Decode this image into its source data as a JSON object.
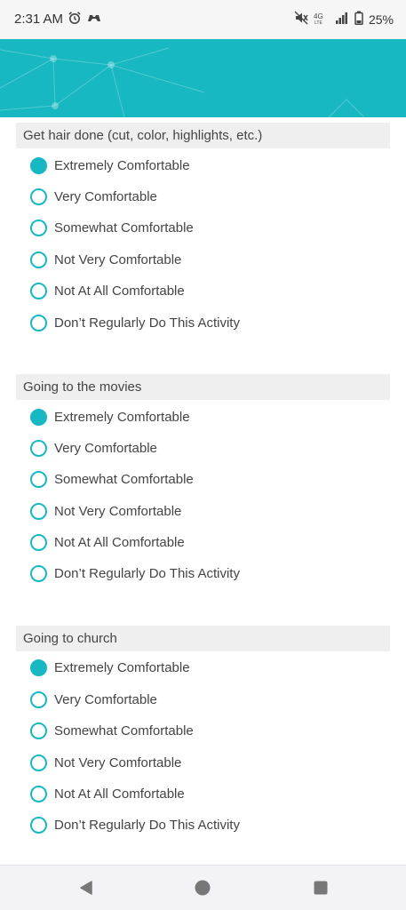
{
  "status_bar": {
    "time": "2:31 AM",
    "battery": "25%",
    "network": "4G LTE"
  },
  "colors": {
    "accent": "#17b8c2",
    "section_bg": "#efefef",
    "text": "#444444"
  },
  "questions": [
    {
      "title": "Get hair done (cut, color, highlights, etc.)",
      "options": [
        {
          "label": "Extremely Comfortable",
          "checked": true
        },
        {
          "label": "Very Comfortable",
          "checked": false
        },
        {
          "label": "Somewhat Comfortable",
          "checked": false
        },
        {
          "label": "Not Very Comfortable",
          "checked": false
        },
        {
          "label": "Not At All Comfortable",
          "checked": false
        },
        {
          "label": "Don’t Regularly Do This Activity",
          "checked": false
        }
      ]
    },
    {
      "title": "Going to the movies",
      "options": [
        {
          "label": "Extremely Comfortable",
          "checked": true
        },
        {
          "label": "Very Comfortable",
          "checked": false
        },
        {
          "label": "Somewhat Comfortable",
          "checked": false
        },
        {
          "label": "Not Very Comfortable",
          "checked": false
        },
        {
          "label": "Not At All Comfortable",
          "checked": false
        },
        {
          "label": "Don’t Regularly Do This Activity",
          "checked": false
        }
      ]
    },
    {
      "title": "Going to church",
      "options": [
        {
          "label": "Extremely Comfortable",
          "checked": true
        },
        {
          "label": "Very Comfortable",
          "checked": false
        },
        {
          "label": "Somewhat Comfortable",
          "checked": false
        },
        {
          "label": "Not Very Comfortable",
          "checked": false
        },
        {
          "label": "Not At All Comfortable",
          "checked": false
        },
        {
          "label": "Don’t Regularly Do This Activity",
          "checked": false
        }
      ]
    }
  ],
  "nav": {
    "back_icon": "back-triangle-icon",
    "home_icon": "home-circle-icon",
    "recents_icon": "recents-square-icon"
  }
}
